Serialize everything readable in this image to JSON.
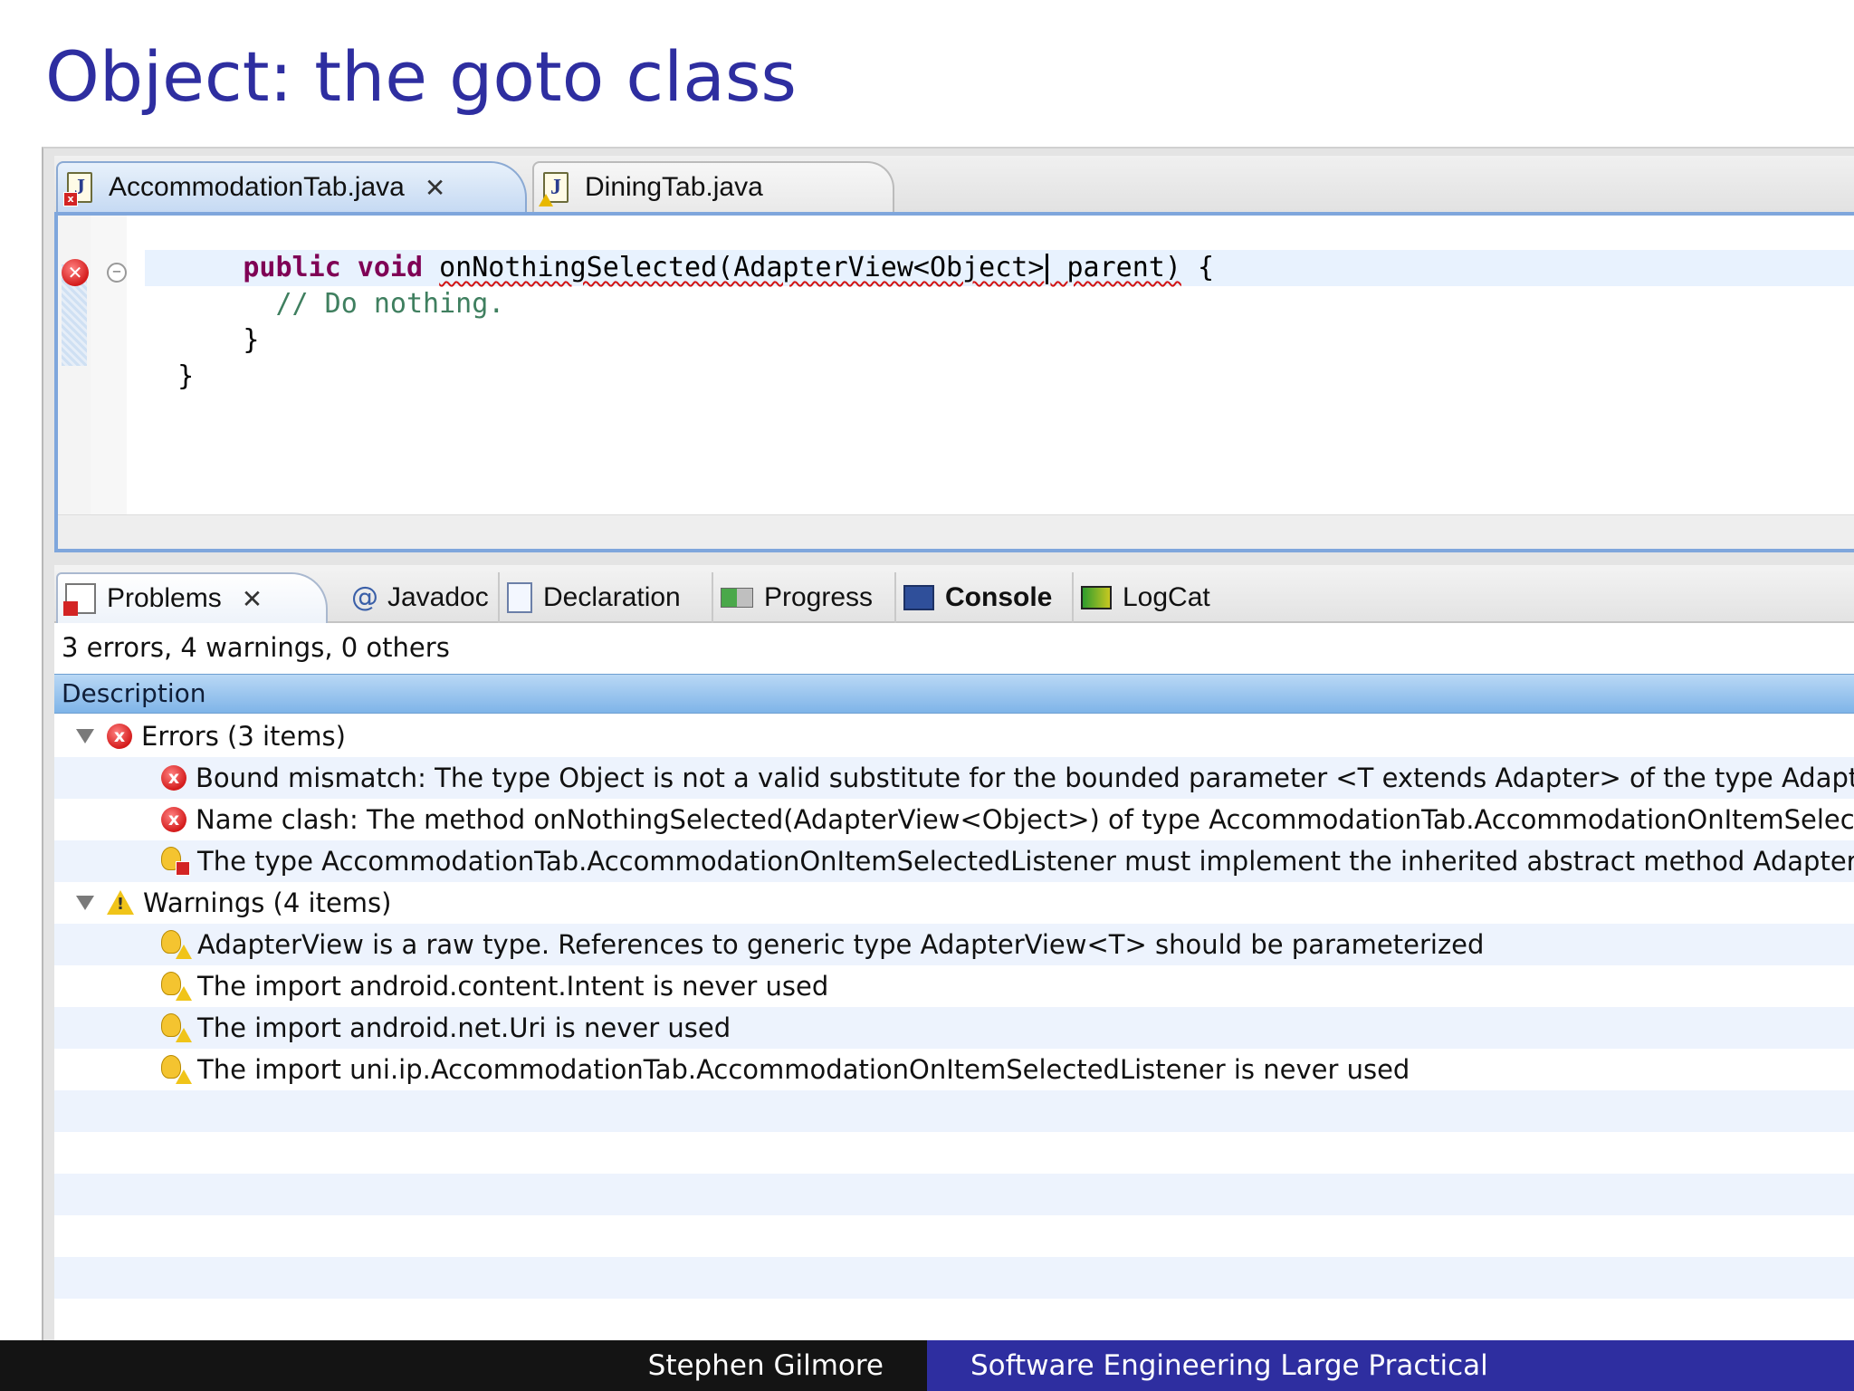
{
  "slide": {
    "title": "Object: the goto class",
    "footer_left": "Stephen Gilmore",
    "footer_right": "Software Engineering Large Practical"
  },
  "editor": {
    "tabs": [
      {
        "label": "AccommodationTab.java",
        "close": "✕",
        "state": "active",
        "badge": "error"
      },
      {
        "label": "DiningTab.java",
        "state": "inactive",
        "badge": "warning"
      }
    ],
    "code": {
      "line1_keywords": "public void",
      "line1_method": "onNothingSelected(AdapterView<Object>",
      "line1_param": " parent)",
      "line1_end": " {",
      "line2_comment": "// Do nothing.",
      "line3": "}",
      "line4": "}"
    },
    "error_marker": "✕",
    "fold_marker": "−"
  },
  "problems_view": {
    "tabs": [
      {
        "label": "Problems",
        "icon": "problems-icon",
        "close": "✕"
      },
      {
        "label": "Javadoc",
        "icon": "at-icon",
        "icon_glyph": "@"
      },
      {
        "label": "Declaration",
        "icon": "declaration-icon"
      },
      {
        "label": "Progress",
        "icon": "progress-icon"
      },
      {
        "label": "Console",
        "icon": "console-icon"
      },
      {
        "label": "LogCat",
        "icon": "logcat-icon"
      }
    ],
    "summary": "3 errors, 4 warnings, 0 others",
    "column_header": "Description",
    "groups": {
      "errors": {
        "label": "Errors (3 items)",
        "items": [
          "Bound mismatch: The type Object is not a valid substitute for the bounded parameter <T extends Adapter> of the type AdapterView<T>",
          "Name clash: The method onNothingSelected(AdapterView<Object>) of type AccommodationTab.AccommodationOnItemSelectedListener",
          "The type AccommodationTab.AccommodationOnItemSelectedListener must implement the inherited abstract method AdapterView"
        ]
      },
      "warnings": {
        "label": "Warnings (4 items)",
        "items": [
          "AdapterView is a raw type. References to generic type AdapterView<T> should be parameterized",
          "The import android.content.Intent is never used",
          "The import android.net.Uri is never used",
          "The import uni.ip.AccommodationTab.AccommodationOnItemSelectedListener is never used"
        ]
      }
    }
  },
  "colors": {
    "title": "#2e2ea0",
    "footer_left_bg": "#141414",
    "footer_right_bg": "#2e2ea0",
    "keyword": "#7f0055",
    "comment": "#3f7f5f",
    "error": "#d32424",
    "warning": "#f0c419",
    "header_blue": "#7fb4e8"
  }
}
